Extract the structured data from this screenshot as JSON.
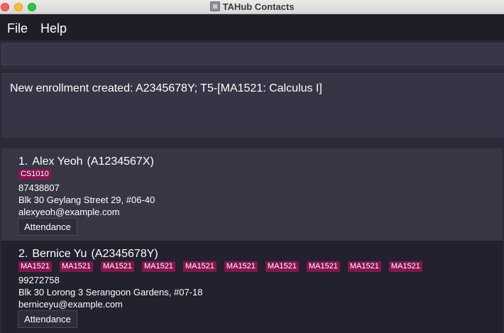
{
  "window": {
    "title": "TAHub Contacts"
  },
  "menu": {
    "file": "File",
    "help": "Help"
  },
  "command": {
    "value": "",
    "placeholder": ""
  },
  "result": {
    "message": "New enrollment created: A2345678Y; T5-[MA1521: Calculus I]"
  },
  "persons": [
    {
      "index": "1.",
      "name": "Alex Yeoh",
      "id": "(A1234567X)",
      "tags": [
        "CS1010"
      ],
      "phone": "87438807",
      "address": "Blk 30 Geylang Street 29, #06-40",
      "email": "alexyeoh@example.com",
      "attendance_label": "Attendance"
    },
    {
      "index": "2.",
      "name": "Bernice Yu",
      "id": "(A2345678Y)",
      "tags": [
        "MA1521",
        "MA1521",
        "MA1521",
        "MA1521",
        "MA1521",
        "MA1521",
        "MA1521",
        "MA1521",
        "MA1521",
        "MA1521"
      ],
      "phone": "99272758",
      "address": "Blk 30 Lorong 3 Serangoon Gardens, #07-18",
      "email": "berniceyu@example.com",
      "attendance_label": "Attendance"
    }
  ],
  "colors": {
    "tag_bg": "#86154f",
    "window_bg": "#2b2a36",
    "menu_bg": "#1e1e29"
  }
}
